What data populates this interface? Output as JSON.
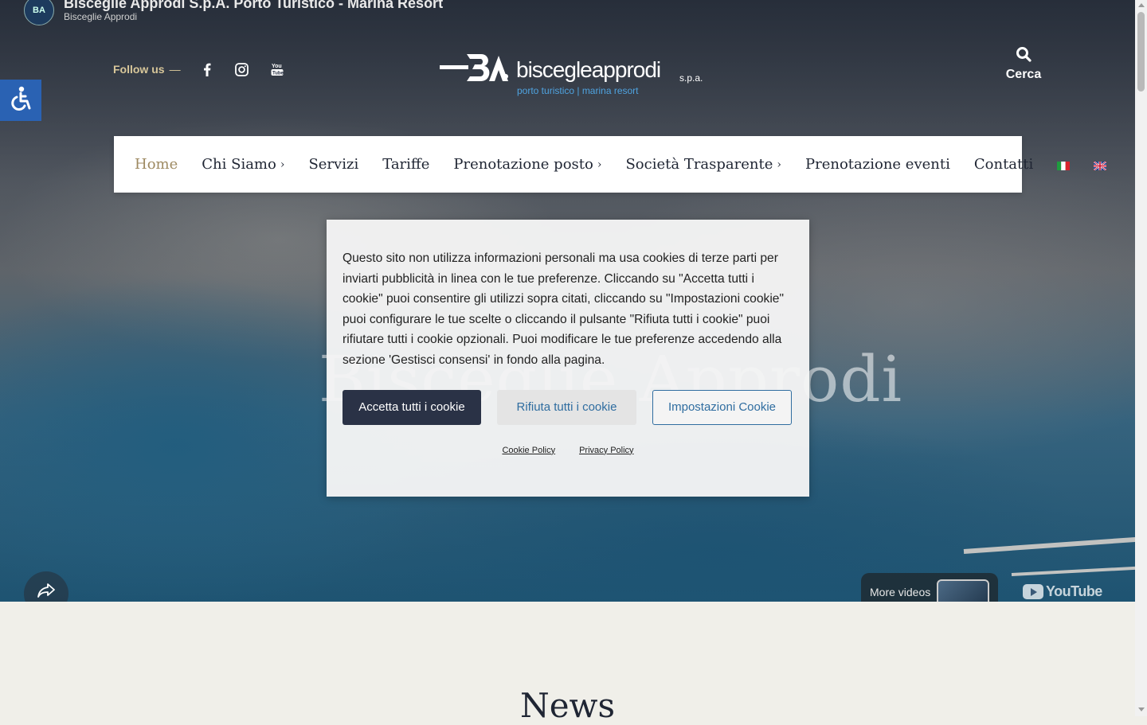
{
  "youtube": {
    "video_title": "Bisceglie Approdi S.p.A. Porto Turistico - Marina Resort",
    "channel": "Bisceglie Approdi",
    "more_videos": "More videos",
    "logo_text": "YouTube"
  },
  "header": {
    "follow_label": "Follow us",
    "follow_dash": "—",
    "social_icons": [
      "facebook-icon",
      "instagram-icon",
      "youtube-icon"
    ],
    "logo_brand": "biscegleapprodi",
    "logo_suffix": "s.p.a.",
    "logo_tagline": "porto turistico | marina resort",
    "search_label": "Cerca"
  },
  "nav": {
    "items": [
      {
        "label": "Home",
        "active": true,
        "submenu": false
      },
      {
        "label": "Chi Siamo",
        "active": false,
        "submenu": true
      },
      {
        "label": "Servizi",
        "active": false,
        "submenu": false
      },
      {
        "label": "Tariffe",
        "active": false,
        "submenu": false
      },
      {
        "label": "Prenotazione posto",
        "active": false,
        "submenu": true
      },
      {
        "label": "Società Trasparente",
        "active": false,
        "submenu": true
      },
      {
        "label": "Prenotazione eventi",
        "active": false,
        "submenu": false
      },
      {
        "label": "Contatti",
        "active": false,
        "submenu": false
      }
    ],
    "flags": [
      "italian-flag-icon",
      "english-flag-icon"
    ],
    "chevron": "›"
  },
  "hero": {
    "title": "Bisceglie Approdi"
  },
  "cookie_banner": {
    "text": "Questo sito non utilizza informazioni personali ma usa cookies di terze parti per inviarti pubblicità in linea con le tue preferenze. Cliccando su \"Accetta tutti i cookie\" puoi consentire gli utilizzi sopra citati, cliccando su \"Impostazioni cookie\" puoi configurare le tue scelte o cliccando il pulsante \"Rifiuta tutti i cookie\" puoi rifiutare tutti i cookie opzionali. Puoi modificare le tue preferenze accedendo alla sezione 'Gestisci consensi' in fondo alla pagina.",
    "accept_label": "Accetta tutti i cookie",
    "reject_label": "Rifiuta tutti i cookie",
    "settings_label": "Impostazioni Cookie",
    "cookie_policy": "Cookie Policy",
    "privacy_policy": "Privacy Policy"
  },
  "news": {
    "heading": "News"
  },
  "colors": {
    "accent_gold": "#9e8a62",
    "navy": "#2a3246",
    "link_blue": "#2f6da0",
    "accessibility_blue": "#2a62b3"
  }
}
